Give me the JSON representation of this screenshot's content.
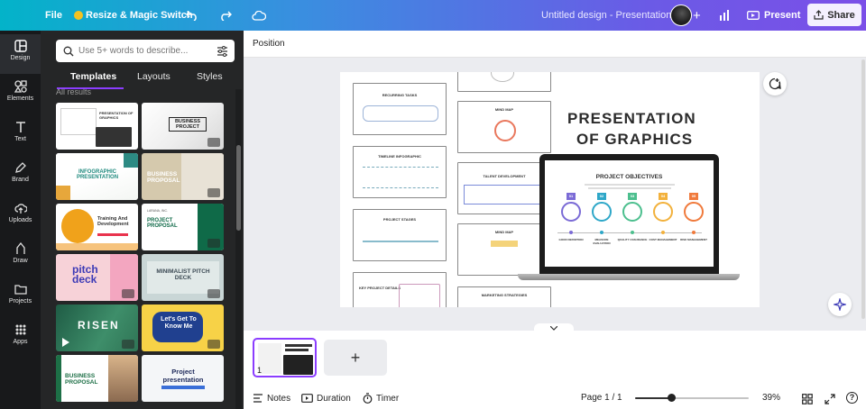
{
  "topbar": {
    "file_label": "File",
    "resize_label": "Resize & Magic Switch",
    "doc_title": "Untitled design - Presentation",
    "present_label": "Present",
    "share_label": "Share"
  },
  "rail": {
    "items": [
      {
        "label": "Design",
        "icon": "design-icon"
      },
      {
        "label": "Elements",
        "icon": "elements-icon"
      },
      {
        "label": "Text",
        "icon": "text-icon"
      },
      {
        "label": "Brand",
        "icon": "brand-icon"
      },
      {
        "label": "Uploads",
        "icon": "uploads-icon"
      },
      {
        "label": "Draw",
        "icon": "draw-icon"
      },
      {
        "label": "Projects",
        "icon": "projects-icon"
      },
      {
        "label": "Apps",
        "icon": "apps-icon"
      }
    ]
  },
  "panel": {
    "search_placeholder": "Use 5+ words to describe...",
    "tabs": [
      "Templates",
      "Layouts",
      "Styles"
    ],
    "results_heading": "All results",
    "templates": [
      {
        "title": "PRESENTATION OF GRAPHICS"
      },
      {
        "title": "BUSINESS PROJECT"
      },
      {
        "title": "INFOGRAPHIC PRESENTATION"
      },
      {
        "title": "BUSINESS PROPOSAL"
      },
      {
        "title": "Training And Development"
      },
      {
        "title": "PROJECT PROPOSAL",
        "sub": "LARANA, INC."
      },
      {
        "title": "pitch deck"
      },
      {
        "title": "MINIMALIST PITCH DECK"
      },
      {
        "title": "RISEN"
      },
      {
        "title": "Let's Get To Know Me"
      },
      {
        "title": "BUSINESS PROPOSAL"
      },
      {
        "title": "Project presentation"
      }
    ]
  },
  "toolbar": {
    "position_label": "Position"
  },
  "slide": {
    "title_line1": "PRESENTATION",
    "title_line2": "OF GRAPHICS",
    "cards": [
      "RECURRING TASKS",
      "MIND MAP",
      "TIMELINE INFOGRAPHIC",
      "TALENT DEVELOPMENT",
      "PROJECT STAGES",
      "MIND MAP",
      "KEY PROJECT DETAILS",
      "MARKETING STRATEGIES"
    ],
    "laptop": {
      "heading": "PROJECT OBJECTIVES",
      "steps": [
        "01",
        "02",
        "03",
        "04",
        "05"
      ],
      "step_labels": [
        "GOOD DEFINITION",
        "MEASURE EVALUATION",
        "QUALITY ASSURANCE",
        "COST MANAGEMENT",
        "RISK MANAGEMENT"
      ]
    }
  },
  "pages": {
    "thumb_number": "1"
  },
  "footer": {
    "notes_label": "Notes",
    "duration_label": "Duration",
    "timer_label": "Timer",
    "page_indicator": "Page 1 / 1",
    "zoom": "39%",
    "zoom_level": 0.39,
    "help": "?"
  },
  "colors": {
    "accent": "#8b3dff",
    "rail_bg": "#18191b",
    "panel_bg": "#252627",
    "steps": [
      "#7b6bd6",
      "#2ea7c8",
      "#4cbf8e",
      "#f2b13c",
      "#f07a3c"
    ]
  }
}
